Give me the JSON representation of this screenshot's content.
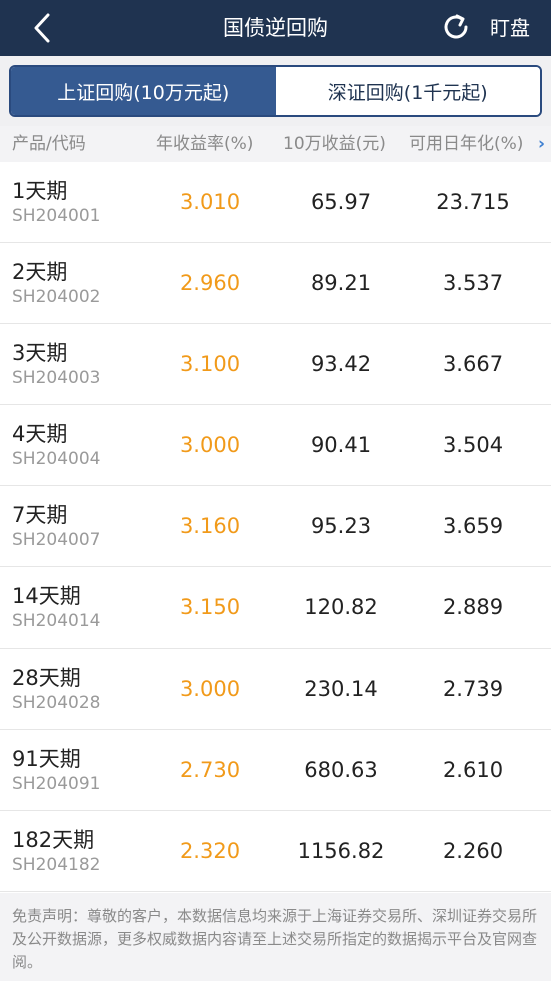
{
  "header": {
    "title": "国债逆回购",
    "watch_label": "盯盘"
  },
  "tabs": [
    {
      "label": "上证回购(10万元起)",
      "active": true
    },
    {
      "label": "深证回购(1千元起)",
      "active": false
    }
  ],
  "columns": {
    "product": "产品/代码",
    "rate": "年收益率(%)",
    "income": "10万收益(元)",
    "annual": "可用日年化(%)",
    "more_arrow": "›"
  },
  "rows": [
    {
      "name": "1天期",
      "code": "SH204001",
      "rate": "3.010",
      "income": "65.97",
      "annual": "23.715"
    },
    {
      "name": "2天期",
      "code": "SH204002",
      "rate": "2.960",
      "income": "89.21",
      "annual": "3.537"
    },
    {
      "name": "3天期",
      "code": "SH204003",
      "rate": "3.100",
      "income": "93.42",
      "annual": "3.667"
    },
    {
      "name": "4天期",
      "code": "SH204004",
      "rate": "3.000",
      "income": "90.41",
      "annual": "3.504"
    },
    {
      "name": "7天期",
      "code": "SH204007",
      "rate": "3.160",
      "income": "95.23",
      "annual": "3.659"
    },
    {
      "name": "14天期",
      "code": "SH204014",
      "rate": "3.150",
      "income": "120.82",
      "annual": "2.889"
    },
    {
      "name": "28天期",
      "code": "SH204028",
      "rate": "3.000",
      "income": "230.14",
      "annual": "2.739"
    },
    {
      "name": "91天期",
      "code": "SH204091",
      "rate": "2.730",
      "income": "680.63",
      "annual": "2.610"
    },
    {
      "name": "182天期",
      "code": "SH204182",
      "rate": "2.320",
      "income": "1156.82",
      "annual": "2.260"
    }
  ],
  "disclaimer": "免责声明：尊敬的客户，本数据信息均来源于上海证券交易所、深圳证券交易所及公开数据源，更多权威数据内容请至上述交易所指定的数据揭示平台及官网查阅。",
  "colors": {
    "header_bg": "#1f3350",
    "tab_active": "#355a91",
    "rate_orange": "#f19a1a"
  }
}
